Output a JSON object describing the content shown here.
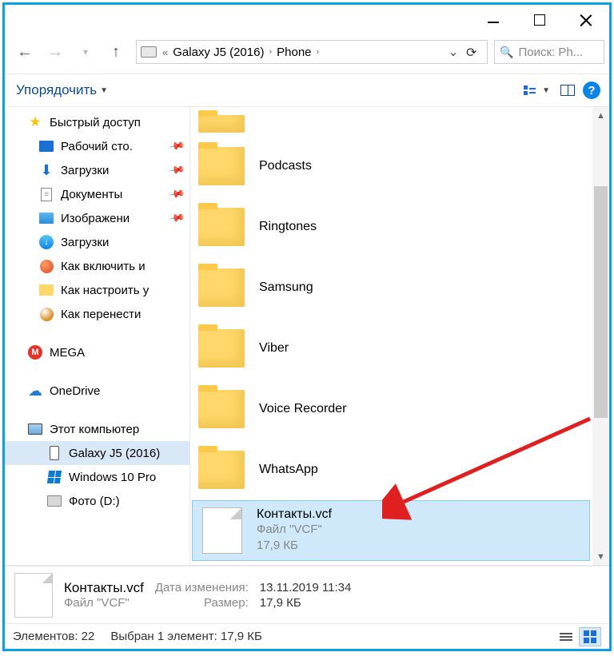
{
  "titlebar": {},
  "address": {
    "crumb_prefix": "«",
    "crumb1": "Galaxy J5 (2016)",
    "crumb2": "Phone"
  },
  "search": {
    "placeholder": "Поиск: Ph..."
  },
  "toolbar": {
    "organize": "Упорядочить"
  },
  "sidebar": {
    "quick_access": "Быстрый доступ",
    "items": [
      {
        "label": "Рабочий сто.",
        "pinned": true,
        "icon": "desktop"
      },
      {
        "label": "Загрузки",
        "pinned": true,
        "icon": "download"
      },
      {
        "label": "Документы",
        "pinned": true,
        "icon": "doc"
      },
      {
        "label": "Изображени",
        "pinned": true,
        "icon": "img"
      },
      {
        "label": "Загрузки",
        "pinned": false,
        "icon": "dlround"
      },
      {
        "label": "Как включить и",
        "pinned": false,
        "icon": "globe"
      },
      {
        "label": "Как настроить у",
        "pinned": false,
        "icon": "folder"
      },
      {
        "label": "Как перенести",
        "pinned": false,
        "icon": "globe2"
      }
    ],
    "mega": "MEGA",
    "onedrive": "OneDrive",
    "this_pc": "Этот компьютер",
    "pc_items": [
      {
        "label": "Galaxy J5 (2016)",
        "icon": "phone",
        "selected": true
      },
      {
        "label": "Windows 10 Pro",
        "icon": "winlogo"
      },
      {
        "label": "Фото  (D:)",
        "icon": "disk"
      }
    ]
  },
  "content": {
    "folders": [
      "Podcasts",
      "Ringtones",
      "Samsung",
      "Viber",
      "Voice Recorder",
      "WhatsApp"
    ],
    "selected_file": {
      "name": "Контакты.vcf",
      "type_line": "Файл \"VCF\"",
      "size": "17,9 КБ"
    }
  },
  "details": {
    "name": "Контакты.vcf",
    "type": "Файл \"VCF\"",
    "mod_label": "Дата изменения:",
    "mod_value": "13.11.2019 11:34",
    "size_label": "Размер:",
    "size_value": "17,9 КБ"
  },
  "status": {
    "elements": "Элементов: 22",
    "selected": "Выбран 1 элемент: 17,9 КБ"
  }
}
